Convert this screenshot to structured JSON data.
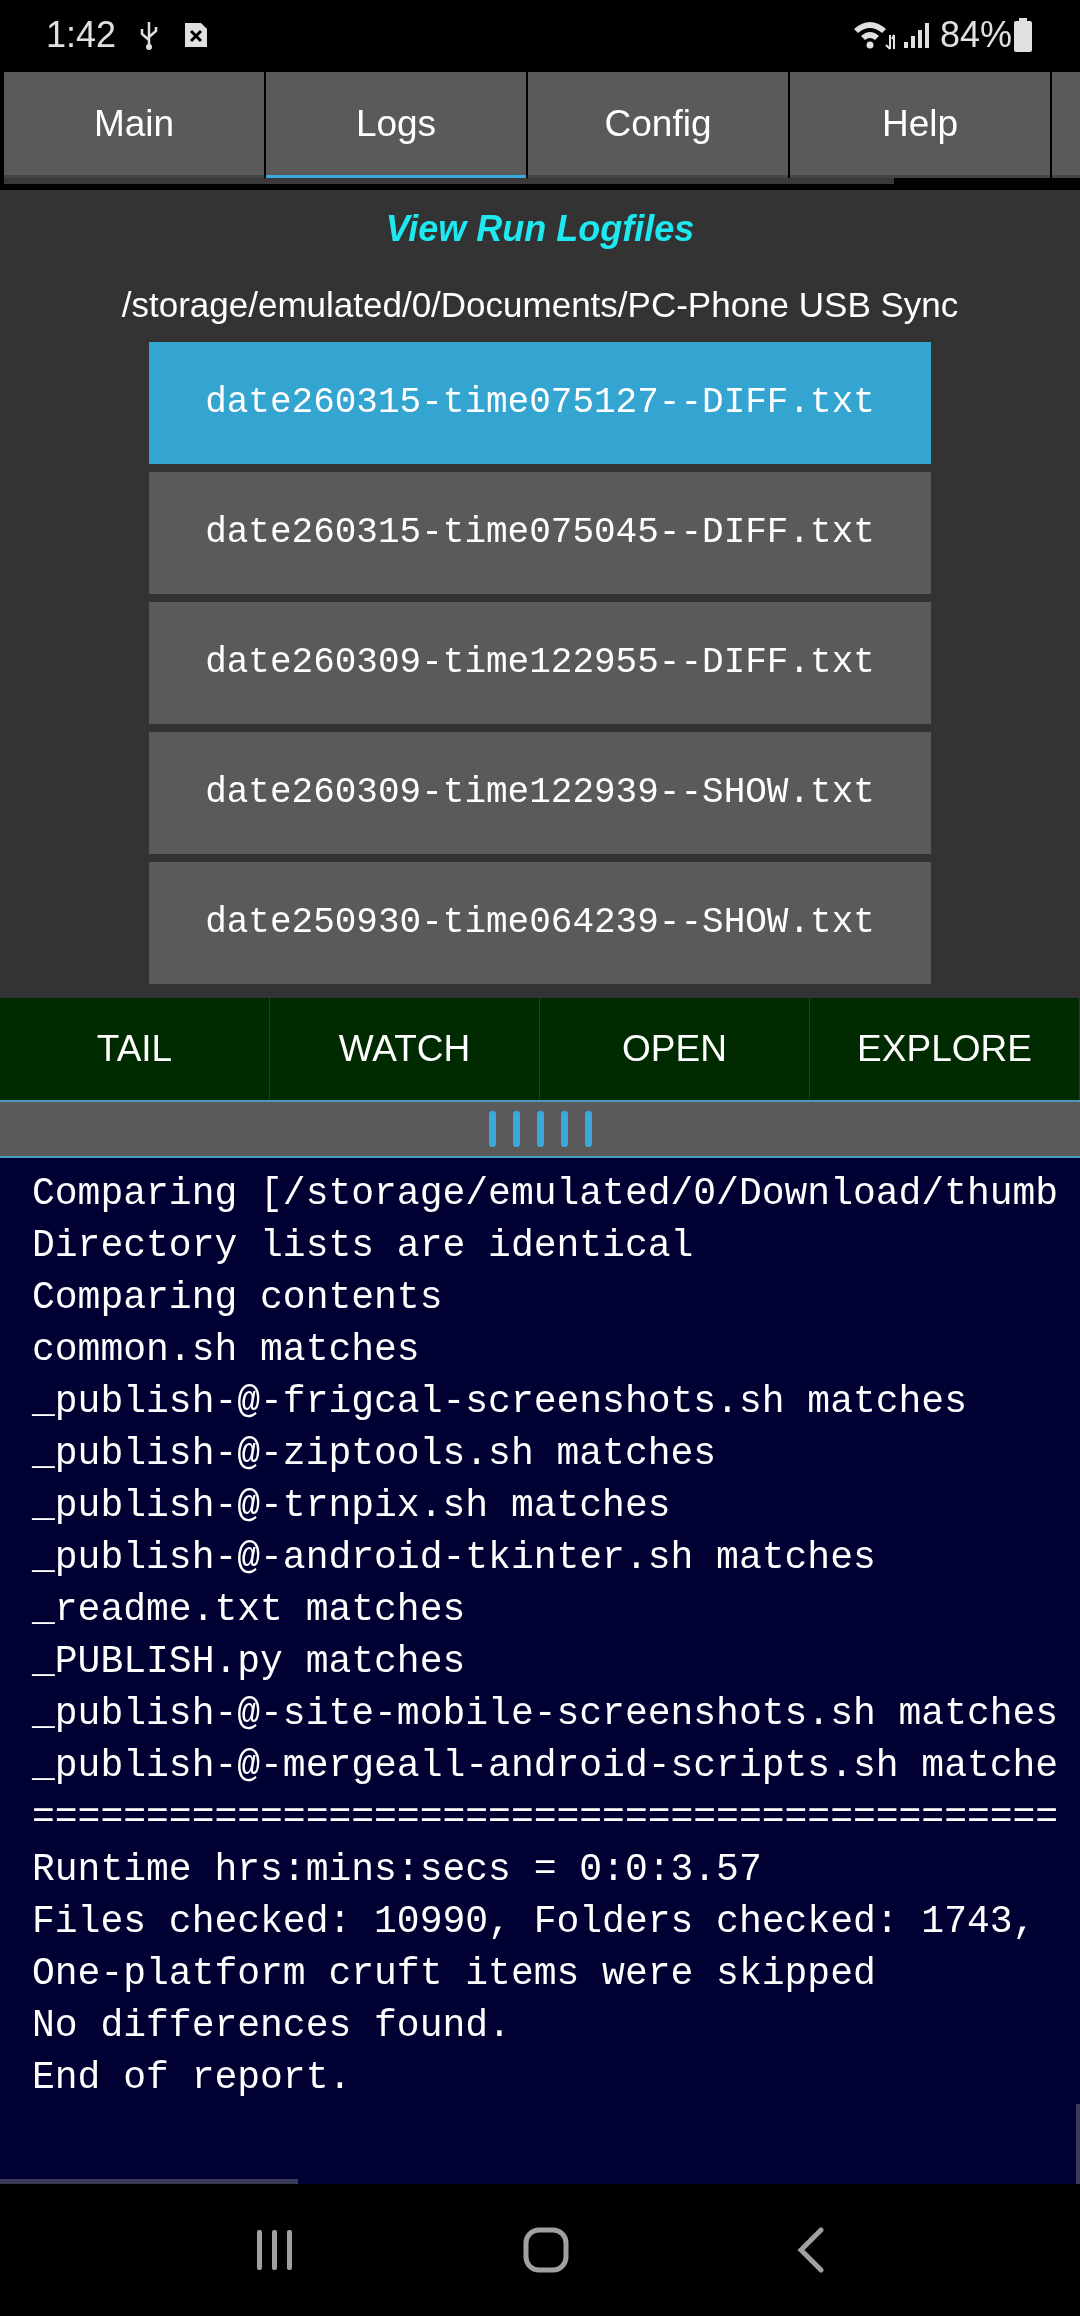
{
  "status_bar": {
    "time": "1:42",
    "battery": "84%"
  },
  "tabs": [
    {
      "label": "Main",
      "selected": false
    },
    {
      "label": "Logs",
      "selected": true
    },
    {
      "label": "Config",
      "selected": false
    },
    {
      "label": "Help",
      "selected": false
    }
  ],
  "title": "View Run Logfiles",
  "path": "/storage/emulated/0/Documents/PC-Phone USB Sync",
  "files": [
    {
      "name": "date260315-time075127--DIFF.txt",
      "selected": true
    },
    {
      "name": "date260315-time075045--DIFF.txt",
      "selected": false
    },
    {
      "name": "date260309-time122955--DIFF.txt",
      "selected": false
    },
    {
      "name": "date260309-time122939--SHOW.txt",
      "selected": false
    },
    {
      "name": "date250930-time064239--SHOW.txt",
      "selected": false
    }
  ],
  "actions": [
    "TAIL",
    "WATCH",
    "OPEN",
    "EXPLORE"
  ],
  "console": {
    "lines": [
      "Comparing [/storage/emulated/0/Download/thumb",
      "Directory lists are identical",
      "Comparing contents",
      "common.sh matches",
      "_publish-@-frigcal-screenshots.sh matches",
      "_publish-@-ziptools.sh matches",
      "_publish-@-trnpix.sh matches",
      "_publish-@-android-tkinter.sh matches",
      "_readme.txt matches",
      "_PUBLISH.py matches",
      "_publish-@-site-mobile-screenshots.sh matches",
      "_publish-@-mergeall-android-scripts.sh matche",
      "=============================================",
      "Runtime hrs:mins:secs = 0:0:3.57",
      "Files checked: 10990, Folders checked: 1743,",
      "One-platform cruft items were skipped",
      "No differences found.",
      "End of report."
    ]
  }
}
